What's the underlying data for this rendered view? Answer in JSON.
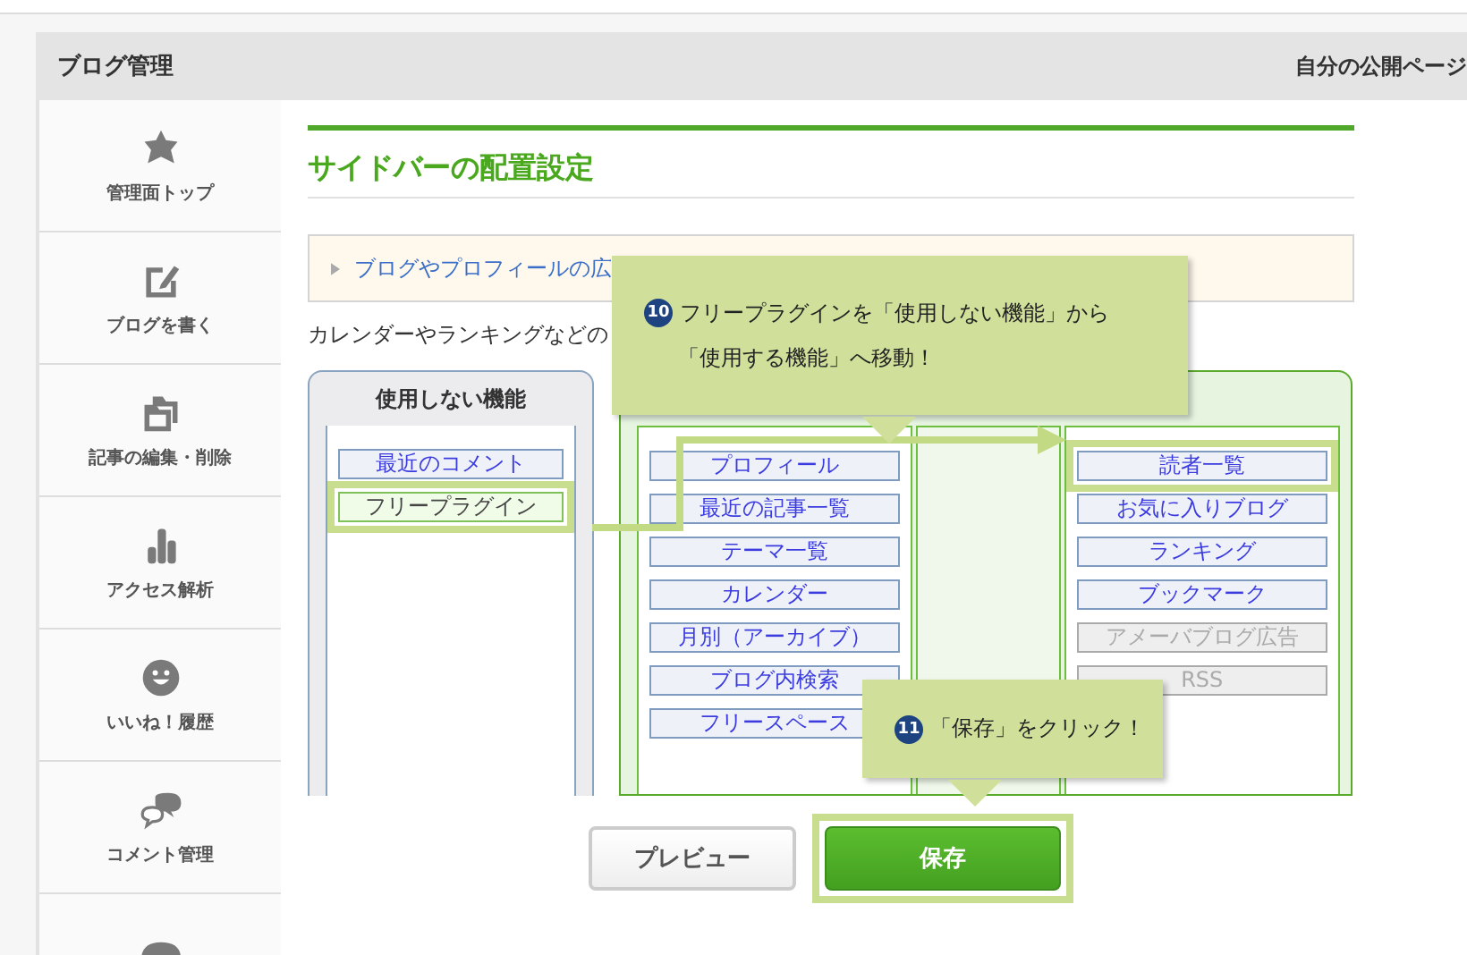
{
  "header": {
    "title": "ブログ管理",
    "link": "自分の公開ページ"
  },
  "sidebar": {
    "items": [
      {
        "kind": "top",
        "label": "管理面トップ"
      },
      {
        "kind": "write",
        "label": "ブログを書く"
      },
      {
        "kind": "folders",
        "label": "記事の編集・削除"
      },
      {
        "kind": "chart",
        "label": "アクセス解析"
      },
      {
        "kind": "smiley",
        "label": "いいね！履歴"
      },
      {
        "kind": "chat",
        "label": "コメント管理"
      },
      {
        "kind": "palette"
      }
    ]
  },
  "page": {
    "title": "サイドバーの配置設定",
    "notice": "ブログやプロフィールの広",
    "description": "カレンダーやランキングなどの"
  },
  "unused": {
    "title": "使用しない機能",
    "items": [
      {
        "label": "最近のコメント",
        "highlighted": false
      },
      {
        "label": "フリープラグイン",
        "highlighted": true
      }
    ]
  },
  "used": {
    "column_a": [
      {
        "label": "プロフィール",
        "disabled": false,
        "highlighted": false
      },
      {
        "label": "最近の記事一覧",
        "disabled": false,
        "highlighted": false
      },
      {
        "label": "テーマ一覧",
        "disabled": false,
        "highlighted": false
      },
      {
        "label": "カレンダー",
        "disabled": false,
        "highlighted": false
      },
      {
        "label": "月別（アーカイブ）",
        "disabled": false,
        "highlighted": false
      },
      {
        "label": "ブログ内検索",
        "disabled": false,
        "highlighted": false
      },
      {
        "label": "フリースペース",
        "disabled": false,
        "highlighted": false
      }
    ],
    "column_c": [
      {
        "label": "読者一覧",
        "disabled": false,
        "highlighted": true
      },
      {
        "label": "お気に入りブログ",
        "disabled": false,
        "highlighted": false
      },
      {
        "label": "ランキング",
        "disabled": false,
        "highlighted": false
      },
      {
        "label": "ブックマーク",
        "disabled": false,
        "highlighted": false
      },
      {
        "label": "アメーバブログ広告",
        "disabled": true,
        "highlighted": false
      },
      {
        "label": "RSS",
        "disabled": true,
        "highlighted": false
      }
    ]
  },
  "buttons": [
    {
      "kind": "preview",
      "label": "プレビュー",
      "highlighted": false
    },
    {
      "kind": "save",
      "label": "保存",
      "highlighted": true
    }
  ],
  "callouts": [
    {
      "number": "10",
      "lines": [
        "フリープラグインを「使用しない機能」から",
        "「使用する機能」へ移動！"
      ]
    },
    {
      "number": "11",
      "lines": [
        "「保存」をクリック！"
      ]
    }
  ]
}
